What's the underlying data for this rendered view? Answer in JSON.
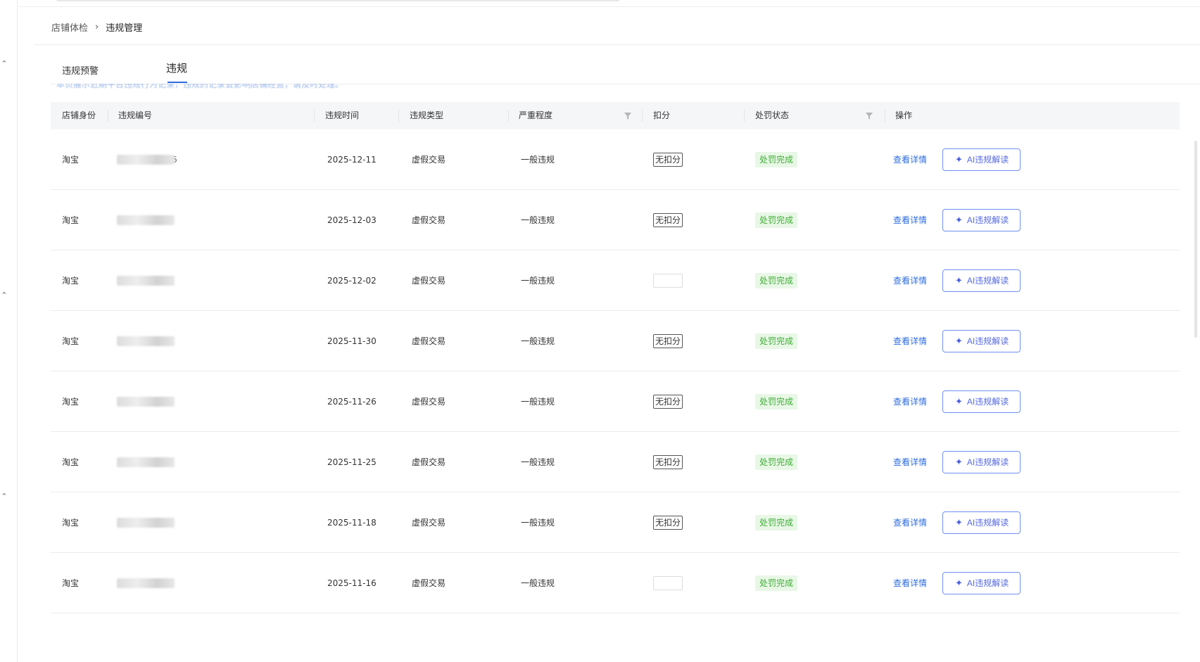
{
  "breadcrumb": {
    "parent": "店铺体检",
    "separator": "›",
    "current": "违规管理"
  },
  "tabs": [
    {
      "label": "违规预警"
    },
    {
      "label": "违规"
    }
  ],
  "notice": "本页展示近期平台违规行为记录，违规的记录会影响店铺经营，请及时处理。",
  "table": {
    "columns": {
      "identity": "店铺身份",
      "code": "违规编号",
      "time": "违规时间",
      "type": "违规类型",
      "severity": "严重程度",
      "points": "扣分",
      "status": "处罚状态",
      "actions": "操作"
    },
    "rows": [
      {
        "identity": "淘宝",
        "code_suffix": "6",
        "time": "2025-12-11",
        "type": "虚假交易",
        "severity": "一般违规",
        "points": "无扣分",
        "status": "处罚完成",
        "detail": "查看详情",
        "ai": "AI违规解读"
      },
      {
        "identity": "淘宝",
        "code_suffix": "",
        "time": "2025-12-03",
        "type": "虚假交易",
        "severity": "一般违规",
        "points": "无扣分",
        "status": "处罚完成",
        "detail": "查看详情",
        "ai": "AI违规解读"
      },
      {
        "identity": "淘宝",
        "code_suffix": "",
        "time": "2025-12-02",
        "type": "虚假交易",
        "severity": "一般违规",
        "points": "",
        "status": "处罚完成",
        "detail": "查看详情",
        "ai": "AI违规解读"
      },
      {
        "identity": "淘宝",
        "code_suffix": "",
        "time": "2025-11-30",
        "type": "虚假交易",
        "severity": "一般违规",
        "points": "无扣分",
        "status": "处罚完成",
        "detail": "查看详情",
        "ai": "AI违规解读"
      },
      {
        "identity": "淘宝",
        "code_suffix": "",
        "time": "2025-11-26",
        "type": "虚假交易",
        "severity": "一般违规",
        "points": "无扣分",
        "status": "处罚完成",
        "detail": "查看详情",
        "ai": "AI违规解读"
      },
      {
        "identity": "淘宝",
        "code_suffix": "",
        "time": "2025-11-25",
        "type": "虚假交易",
        "severity": "一般违规",
        "points": "无扣分",
        "status": "处罚完成",
        "detail": "查看详情",
        "ai": "AI违规解读"
      },
      {
        "identity": "淘宝",
        "code_suffix": "",
        "time": "2025-11-18",
        "type": "虚假交易",
        "severity": "一般违规",
        "points": "无扣分",
        "status": "处罚完成",
        "detail": "查看详情",
        "ai": "AI违规解读"
      },
      {
        "identity": "淘宝",
        "code_suffix": "",
        "time": "2025-11-16",
        "type": "虚假交易",
        "severity": "一般违规",
        "points": "",
        "status": "处罚完成",
        "detail": "查看详情",
        "ai": "AI违规解读"
      }
    ]
  },
  "icons": {
    "ai_button": "sparkle-icon",
    "column_filter": "filter-icon",
    "rail": "chevron-up-icon"
  },
  "colors": {
    "link": "#2d6cdf",
    "status_bg": "#e8f7e6",
    "status_text": "#3fae35",
    "ai_border": "#6f8ff0",
    "ai_text": "#5569e0"
  }
}
